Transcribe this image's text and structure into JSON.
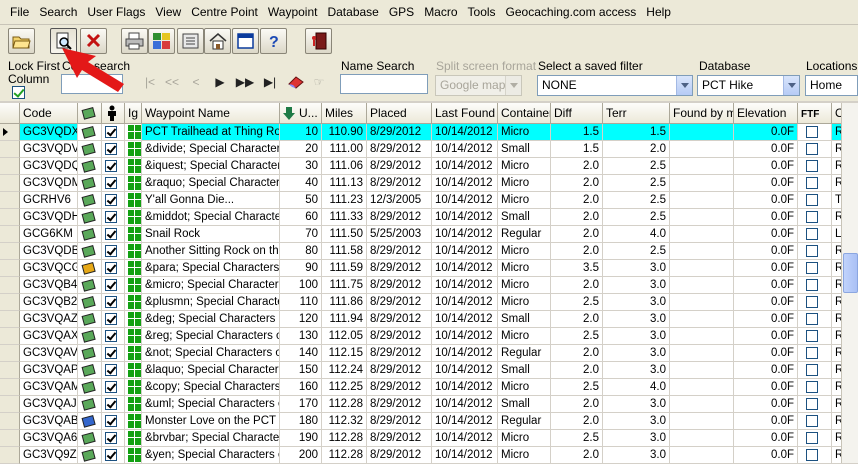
{
  "menu": [
    "File",
    "Search",
    "User Flags",
    "View",
    "Centre Point",
    "Waypoint",
    "Database",
    "GPS",
    "Macro",
    "Tools",
    "Geocaching.com access",
    "Help"
  ],
  "toolbar": {
    "buttons": [
      "open-icon",
      "find-icon",
      "close-icon",
      "print-icon",
      "grid-icon",
      "settings-icon",
      "home-icon",
      "window-icon",
      "help-icon",
      "exit-icon"
    ]
  },
  "filterbar": {
    "lock_first_label": "Lock First",
    "column_label": "Column",
    "code_search_label": "Code search",
    "name_search_label": "Name Search",
    "split_screen_label": "Split screen format",
    "split_screen_value": "Google maps",
    "saved_filter_label": "Select a saved filter",
    "saved_filter_value": "NONE",
    "database_label": "Database",
    "database_value": "PCT Hike",
    "locations_label": "Locations",
    "locations_value": "Home",
    "nav_buttons": [
      "|<",
      "<<",
      "<",
      ">",
      ">>",
      ">|"
    ]
  },
  "grid": {
    "columns": [
      "",
      "Code",
      "",
      "",
      "Ig",
      "Waypoint Name",
      "U...",
      "Miles",
      "Placed",
      "Last Found",
      "Container",
      "Diff",
      "Terr",
      "Found by me",
      "Elevation",
      "FTF",
      "Own"
    ],
    "rows": [
      {
        "code": "GC3VQDX",
        "name": "PCT Trailhead at Thing Roa",
        "u": "10",
        "miles": "110.90",
        "placed": "8/29/2012",
        "last": "10/14/2012",
        "container": "Micro",
        "diff": "1.5",
        "terr": "1.5",
        "elev": "0.0F",
        "owner": "Ragl",
        "selected": true
      },
      {
        "code": "GC3VQDV",
        "name": "&divide; Special Characters",
        "u": "20",
        "miles": "111.00",
        "placed": "8/29/2012",
        "last": "10/14/2012",
        "container": "Small",
        "diff": "1.5",
        "terr": "2.0",
        "elev": "0.0F",
        "owner": "Ragl"
      },
      {
        "code": "GC3VQDQ",
        "name": "&iquest; Special Characters",
        "u": "30",
        "miles": "111.06",
        "placed": "8/29/2012",
        "last": "10/14/2012",
        "container": "Micro",
        "diff": "2.0",
        "terr": "2.5",
        "elev": "0.0F",
        "owner": "Ragl"
      },
      {
        "code": "GC3VQDM",
        "name": "&raquo; Special Characters o",
        "u": "40",
        "miles": "111.13",
        "placed": "8/29/2012",
        "last": "10/14/2012",
        "container": "Micro",
        "diff": "2.0",
        "terr": "2.5",
        "elev": "0.0F",
        "owner": "Ragl"
      },
      {
        "code": "GCRHV6",
        "name": "Y'all Gonna Die...",
        "u": "50",
        "miles": "111.23",
        "placed": "12/3/2005",
        "last": "10/14/2012",
        "container": "Micro",
        "diff": "2.0",
        "terr": "2.5",
        "elev": "0.0F",
        "owner": "Trail"
      },
      {
        "code": "GC3VQDH",
        "name": "&middot; Special Characters",
        "u": "60",
        "miles": "111.33",
        "placed": "8/29/2012",
        "last": "10/14/2012",
        "container": "Small",
        "diff": "2.0",
        "terr": "2.5",
        "elev": "0.0F",
        "owner": "Ragl"
      },
      {
        "code": "GCG6KM",
        "name": "Snail Rock",
        "u": "70",
        "miles": "111.50",
        "placed": "5/25/2003",
        "last": "10/14/2012",
        "container": "Regular",
        "diff": "2.0",
        "terr": "4.0",
        "elev": "0.0F",
        "owner": "Loca"
      },
      {
        "code": "GC3VQDB",
        "name": "Another Sitting Rock on the",
        "u": "80",
        "miles": "111.58",
        "placed": "8/29/2012",
        "last": "10/14/2012",
        "container": "Micro",
        "diff": "2.0",
        "terr": "2.5",
        "elev": "0.0F",
        "owner": "Ragl"
      },
      {
        "code": "GC3VQCG",
        "name": "&para; Special Characters on",
        "u": "90",
        "miles": "111.59",
        "placed": "8/29/2012",
        "last": "10/14/2012",
        "container": "Micro",
        "diff": "3.5",
        "terr": "3.0",
        "elev": "0.0F",
        "owner": "Ragl"
      },
      {
        "code": "GC3VQB4",
        "name": "&micro; Special Characters on",
        "u": "100",
        "miles": "111.75",
        "placed": "8/29/2012",
        "last": "10/14/2012",
        "container": "Micro",
        "diff": "2.0",
        "terr": "3.0",
        "elev": "0.0F",
        "owner": "Ragl"
      },
      {
        "code": "GC3VQB2",
        "name": "&plusmn; Special Characters",
        "u": "110",
        "miles": "111.86",
        "placed": "8/29/2012",
        "last": "10/14/2012",
        "container": "Micro",
        "diff": "2.5",
        "terr": "3.0",
        "elev": "0.0F",
        "owner": "Ragl"
      },
      {
        "code": "GC3VQAZ",
        "name": "&deg; Special Characters on",
        "u": "120",
        "miles": "111.94",
        "placed": "8/29/2012",
        "last": "10/14/2012",
        "container": "Small",
        "diff": "2.0",
        "terr": "3.0",
        "elev": "0.0F",
        "owner": "Ragl"
      },
      {
        "code": "GC3VQAX",
        "name": "&reg; Special Characters on",
        "u": "130",
        "miles": "112.05",
        "placed": "8/29/2012",
        "last": "10/14/2012",
        "container": "Micro",
        "diff": "2.5",
        "terr": "3.0",
        "elev": "0.0F",
        "owner": "Ragl"
      },
      {
        "code": "GC3VQAV",
        "name": "&not; Special Characters on",
        "u": "140",
        "miles": "112.15",
        "placed": "8/29/2012",
        "last": "10/14/2012",
        "container": "Regular",
        "diff": "2.0",
        "terr": "3.0",
        "elev": "0.0F",
        "owner": "Ragl"
      },
      {
        "code": "GC3VQAP",
        "name": "&laquo; Special Characters o",
        "u": "150",
        "miles": "112.24",
        "placed": "8/29/2012",
        "last": "10/14/2012",
        "container": "Small",
        "diff": "2.0",
        "terr": "3.0",
        "elev": "0.0F",
        "owner": "Ragl"
      },
      {
        "code": "GC3VQAM",
        "name": "&copy; Special Characters on",
        "u": "160",
        "miles": "112.25",
        "placed": "8/29/2012",
        "last": "10/14/2012",
        "container": "Micro",
        "diff": "2.5",
        "terr": "4.0",
        "elev": "0.0F",
        "owner": "Ragl"
      },
      {
        "code": "GC3VQAJ",
        "name": "&uml; Special Characters on",
        "u": "170",
        "miles": "112.28",
        "placed": "8/29/2012",
        "last": "10/14/2012",
        "container": "Small",
        "diff": "2.0",
        "terr": "3.0",
        "elev": "0.0F",
        "owner": "Ragl"
      },
      {
        "code": "GC3VQAB",
        "name": "Monster Love on the PCT",
        "u": "180",
        "miles": "112.32",
        "placed": "8/29/2012",
        "last": "10/14/2012",
        "container": "Regular",
        "diff": "2.0",
        "terr": "3.0",
        "elev": "0.0F",
        "owner": "Ragl"
      },
      {
        "code": "GC3VQA6",
        "name": "&brvbar; Special Characters",
        "u": "190",
        "miles": "112.28",
        "placed": "8/29/2012",
        "last": "10/14/2012",
        "container": "Micro",
        "diff": "2.5",
        "terr": "3.0",
        "elev": "0.0F",
        "owner": "Ragl"
      },
      {
        "code": "GC3VQ9Z",
        "name": "&yen; Special Characters on",
        "u": "200",
        "miles": "112.28",
        "placed": "8/29/2012",
        "last": "10/14/2012",
        "container": "Micro",
        "diff": "2.0",
        "terr": "3.0",
        "elev": "0.0F",
        "owner": "Ragl"
      }
    ]
  },
  "colors": {
    "selected_row": "#00ffff",
    "accent_green": "#12a012",
    "arrow_red": "#e31818"
  }
}
